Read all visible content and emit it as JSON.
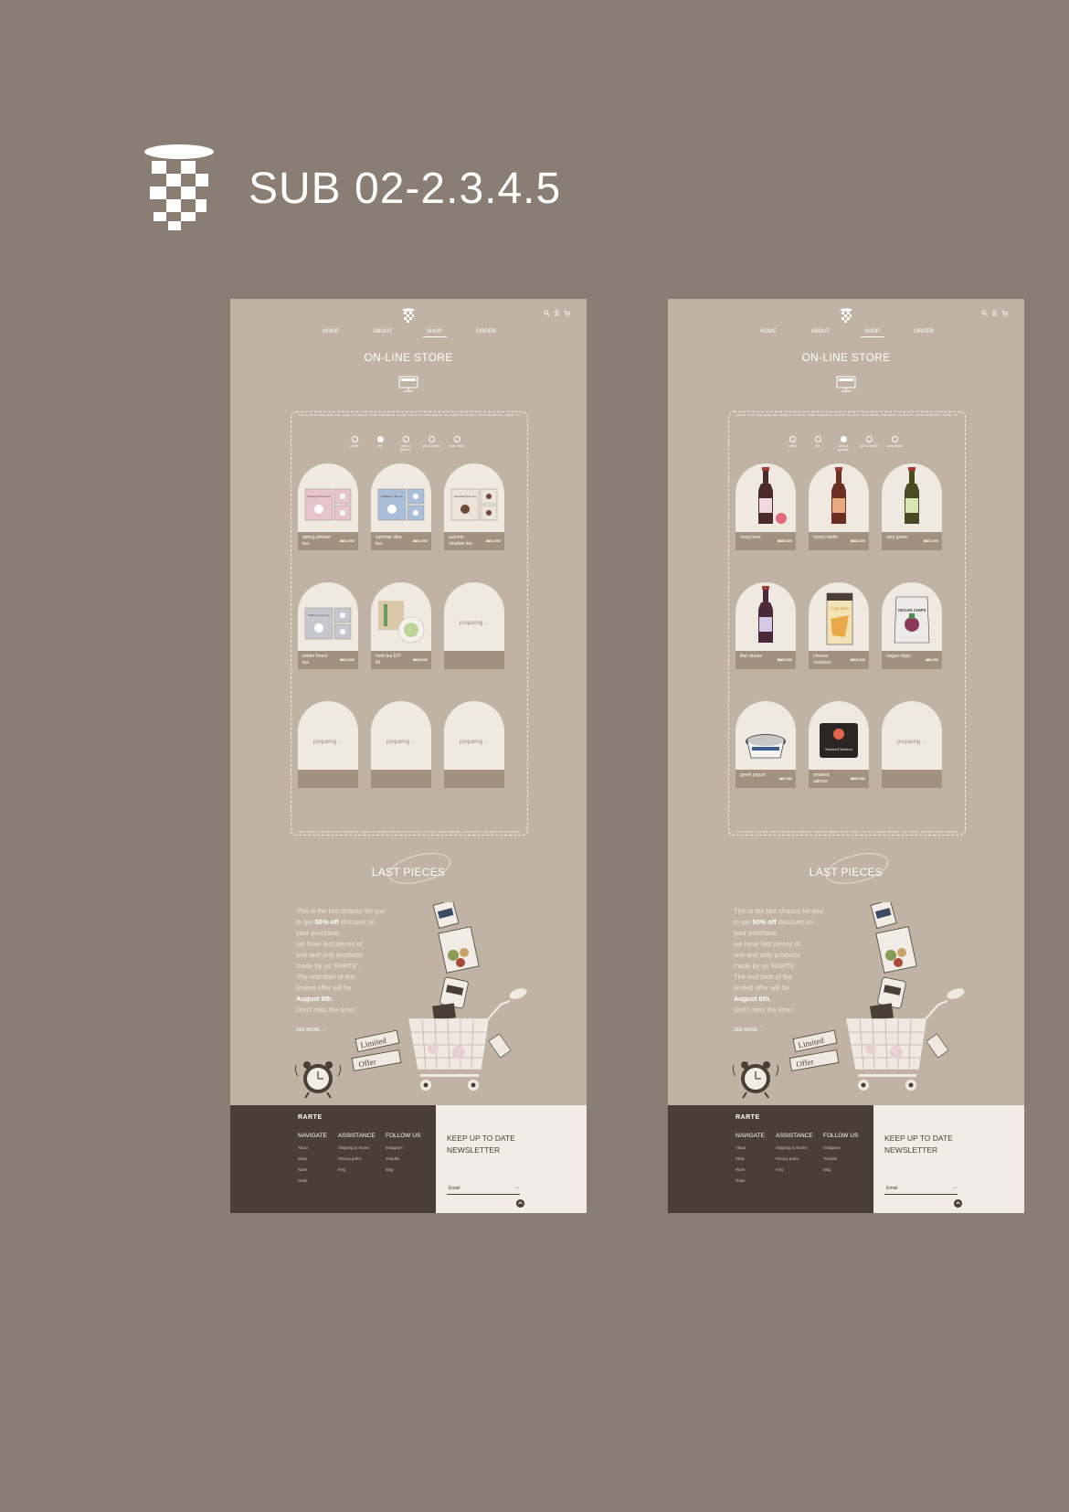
{
  "project": {
    "title": "SUB 02-2.3.4.5"
  },
  "colors": {
    "background": "#8a7e74",
    "mock_bg": "#c0b3a4",
    "card_arch": "#efe9e1",
    "card_strip": "#a2917f",
    "footer_dark": "#4a3f37",
    "footer_light": "#f1ece5"
  },
  "mockups": [
    {
      "nav": [
        "HOME",
        "ABOUT",
        "SHOP",
        "ORDER"
      ],
      "active_nav": "SHOP",
      "store_title": "ON-LINE STORE",
      "frame_text_top": "ENJOY OUR TIME HERE. WE HOPE YOU ENJOY YOUR SHOPPING. THANK YOU FOR YOUR RARTE. WE HOPE YOU ENJOY YOUR SHOPPING. THANK YOU FOR YOUR ENJOY OUR TIME HERE. WE HOPE YOU ENJOY",
      "frame_text_bottom": "JUST ENJOY THE DELICIOUS SHOPPING. RARTE IS THE BEST BRAND WITH TASTE. YOU WILL NEVER REGRET. JUST ENJOY THE DELICIOUS SHOPPING. RARTE IS THE BEST",
      "categories": [
        {
          "label": "coffee",
          "selected": false
        },
        {
          "label": "tea",
          "selected": true
        },
        {
          "label": "wine & grocery",
          "selected": false
        },
        {
          "label": "jam & bread",
          "selected": false
        },
        {
          "label": "hand made",
          "selected": false
        }
      ],
      "products": [
        {
          "name": "spring shower tea",
          "price": "₩21,000",
          "pack_title": "Spring shower tea"
        },
        {
          "name": "summer vibe tea",
          "price": "₩21,000",
          "pack_title": "Summer vibe tea"
        },
        {
          "name": "autumn shadow tea",
          "price": "₩21,000",
          "pack_title": "Autumn glow tea"
        },
        {
          "name": "winter forest tea",
          "price": "₩21,000",
          "pack_title": "Winter forest tea"
        },
        {
          "name": "herb tea DIY kit",
          "price": "₩29,000",
          "pack_title": ""
        },
        {
          "name": "",
          "price": "",
          "preparing": "preparing ..."
        },
        {
          "name": "",
          "price": "",
          "preparing": "preparing ..."
        },
        {
          "name": "",
          "price": "",
          "preparing": "preparing ..."
        },
        {
          "name": "",
          "price": "",
          "preparing": "preparing ..."
        }
      ],
      "last_title": "LAST PIECES",
      "promo": {
        "l1": "This is the last chance for you",
        "l2a": "to get ",
        "l2b": "50% off",
        "l2c": " discount on",
        "l3": "your purchase.",
        "l4": "we have last pieces of",
        "l5": "one and only products",
        "l6": "made by us 'RARTE'.",
        "l7": "The end date of the",
        "l8": "limited offer will be",
        "l9": "August 6th.",
        "l10": "Don't miss the time !"
      },
      "see_more": "SEE MORE →",
      "tag_text": [
        "Limited",
        "Offer"
      ],
      "footer": {
        "brand": "RARTE",
        "navigate": {
          "title": "NAVIGATE",
          "items": [
            "About",
            "Shop",
            "Rarte",
            "Order"
          ]
        },
        "assistance": {
          "title": "ASSISTANCE",
          "items": [
            "Shipping & returns",
            "Privacy police",
            "FAQ"
          ]
        },
        "follow": {
          "title": "FOLLOW US",
          "items": [
            "Instagram",
            "Youtube",
            "Blog"
          ]
        },
        "newsletter_l1": "KEEP UP TO DATE",
        "newsletter_l2": "NEWSLETTER",
        "email_placeholder": "Email",
        "arrow": "→"
      }
    },
    {
      "nav": [
        "HOME",
        "ABOUT",
        "SHOP",
        "ORDER"
      ],
      "active_nav": "SHOP",
      "store_title": "ON-LINE STORE",
      "frame_text_top": "ENJOY OUR TIME HERE. WE HOPE YOU ENJOY YOUR SHOPPING. THANK YOU FOR YOUR RARTE. WE HOPE YOU ENJOY YOUR SHOPPING. THANK YOU FOR YOUR ENJOY OUR TIME HERE. WE HOPE YOU ENJOY",
      "frame_text_bottom": "JUST ENJOY THE DELICIOUS SHOPPING. RARTE IS THE BEST BRAND WITH TASTE. YOU WILL NEVER REGRET. JUST ENJOY THE DELICIOUS SHOPPING. RARTE IS THE BEST",
      "categories": [
        {
          "label": "coffee",
          "selected": false
        },
        {
          "label": "tea",
          "selected": false
        },
        {
          "label": "wine & grocery",
          "selected": true
        },
        {
          "label": "jam & bread",
          "selected": false
        },
        {
          "label": "hand made",
          "selected": false
        }
      ],
      "products": [
        {
          "name": "crazy love",
          "price": "₩35,000",
          "pack_title": ""
        },
        {
          "name": "honey melts",
          "price": "₩32,000",
          "pack_title": ""
        },
        {
          "name": "very green",
          "price": "₩37,000",
          "pack_title": ""
        },
        {
          "name": "lilac dream",
          "price": "₩25,000",
          "pack_title": ""
        },
        {
          "name": "cheese crackers",
          "price": "₩15,000",
          "pack_title": "Crackers"
        },
        {
          "name": "vegan chips",
          "price": "₩6,000",
          "pack_title": "VEGAN CHIPS"
        },
        {
          "name": "greek yogurt",
          "price": "₩7,000",
          "pack_title": ""
        },
        {
          "name": "smoked salmon",
          "price": "₩30,000",
          "pack_title": "Smoked Salmon"
        },
        {
          "name": "",
          "price": "",
          "preparing": "preparing ..."
        }
      ],
      "last_title": "LAST PIECES",
      "promo": {
        "l1": "This is the last chance for you",
        "l2a": "to get ",
        "l2b": "50% off",
        "l2c": " discount on",
        "l3": "your purchase.",
        "l4": "we have last pieces of",
        "l5": "one and only products",
        "l6": "made by us 'RARTE'.",
        "l7": "The end date of the",
        "l8": "limited offer will be",
        "l9": "August 6th.",
        "l10": "Don't miss the time !"
      },
      "see_more": "SEE MORE →",
      "tag_text": [
        "Limited",
        "Offer"
      ],
      "footer": {
        "brand": "RARTE",
        "navigate": {
          "title": "NAVIGATE",
          "items": [
            "About",
            "Shop",
            "Rarte",
            "Order"
          ]
        },
        "assistance": {
          "title": "ASSISTANCE",
          "items": [
            "Shipping & returns",
            "Privacy police",
            "FAQ"
          ]
        },
        "follow": {
          "title": "FOLLOW US",
          "items": [
            "Instagram",
            "Youtube",
            "Blog"
          ]
        },
        "newsletter_l1": "KEEP UP TO DATE",
        "newsletter_l2": "NEWSLETTER",
        "email_placeholder": "Email",
        "arrow": "→"
      }
    }
  ]
}
